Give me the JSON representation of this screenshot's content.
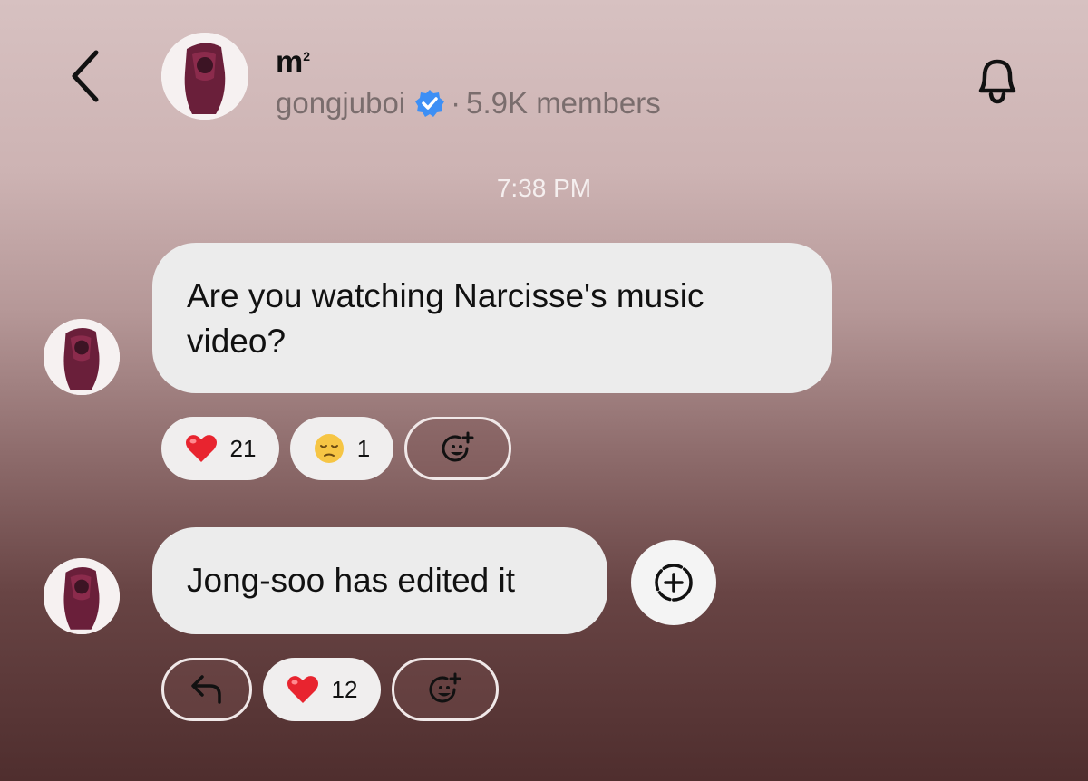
{
  "header": {
    "title": "m",
    "title_superscript": "2",
    "channel_owner": "gongjuboi",
    "separator": "·",
    "member_count": "5.9K members"
  },
  "colors": {
    "verified_badge": "#3d8ff5",
    "bubble": "#ececec"
  },
  "timestamp": "7:38 PM",
  "messages": [
    {
      "text": "Are you watching Narcisse's music video?",
      "reactions": [
        {
          "emoji": "❤️",
          "icon": "heart-emoji",
          "count": "21"
        },
        {
          "emoji": "😔",
          "icon": "pensive-face-emoji",
          "count": "1"
        }
      ]
    },
    {
      "text": "Jong-soo has edited it",
      "reactions": [
        {
          "emoji": "❤️",
          "icon": "heart-emoji",
          "count": "12"
        }
      ]
    }
  ],
  "icons": {
    "back": "chevron-left-icon",
    "bell": "bell-icon",
    "add_reaction": "smiley-plus-icon",
    "reply": "reply-icon",
    "add_circle": "dashed-circle-plus-icon"
  }
}
